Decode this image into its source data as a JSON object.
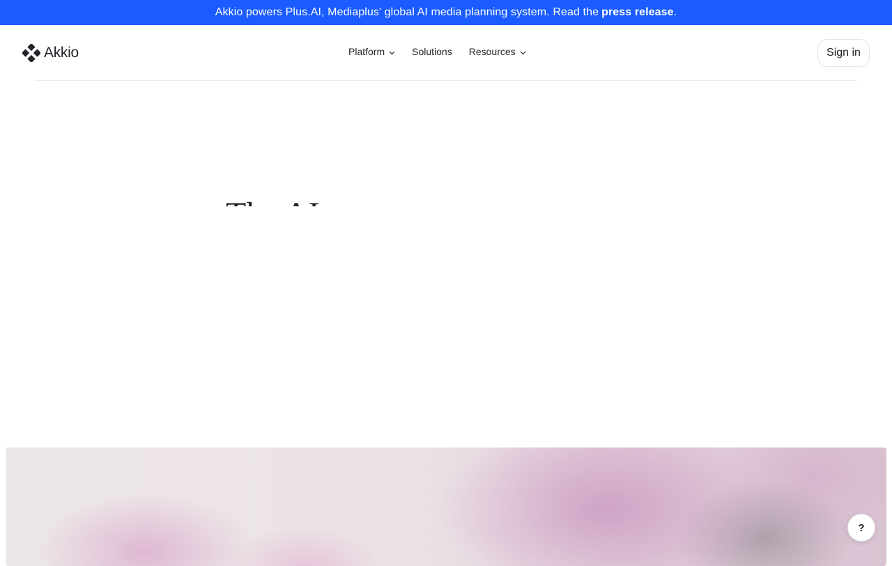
{
  "announcement": {
    "text": "Akkio powers Plus.AI, Mediaplus' global AI media planning system. Read the",
    "link_label": "press release",
    "suffix": ".",
    "background_color": "#1a5cff"
  },
  "header": {
    "logo_text": "Akkio",
    "logo_icon": "akkio-diamond-logo-icon",
    "nav": [
      {
        "label": "Platform",
        "has_dropdown": true,
        "icon": "chevron-down-icon"
      },
      {
        "label": "Solutions",
        "has_dropdown": false
      },
      {
        "label": "Resources",
        "has_dropdown": true,
        "icon": "chevron-down-icon"
      }
    ],
    "signin_label": "Sign in"
  },
  "hero": {
    "heading_partial": "The AI age"
  },
  "help": {
    "label": "?"
  }
}
